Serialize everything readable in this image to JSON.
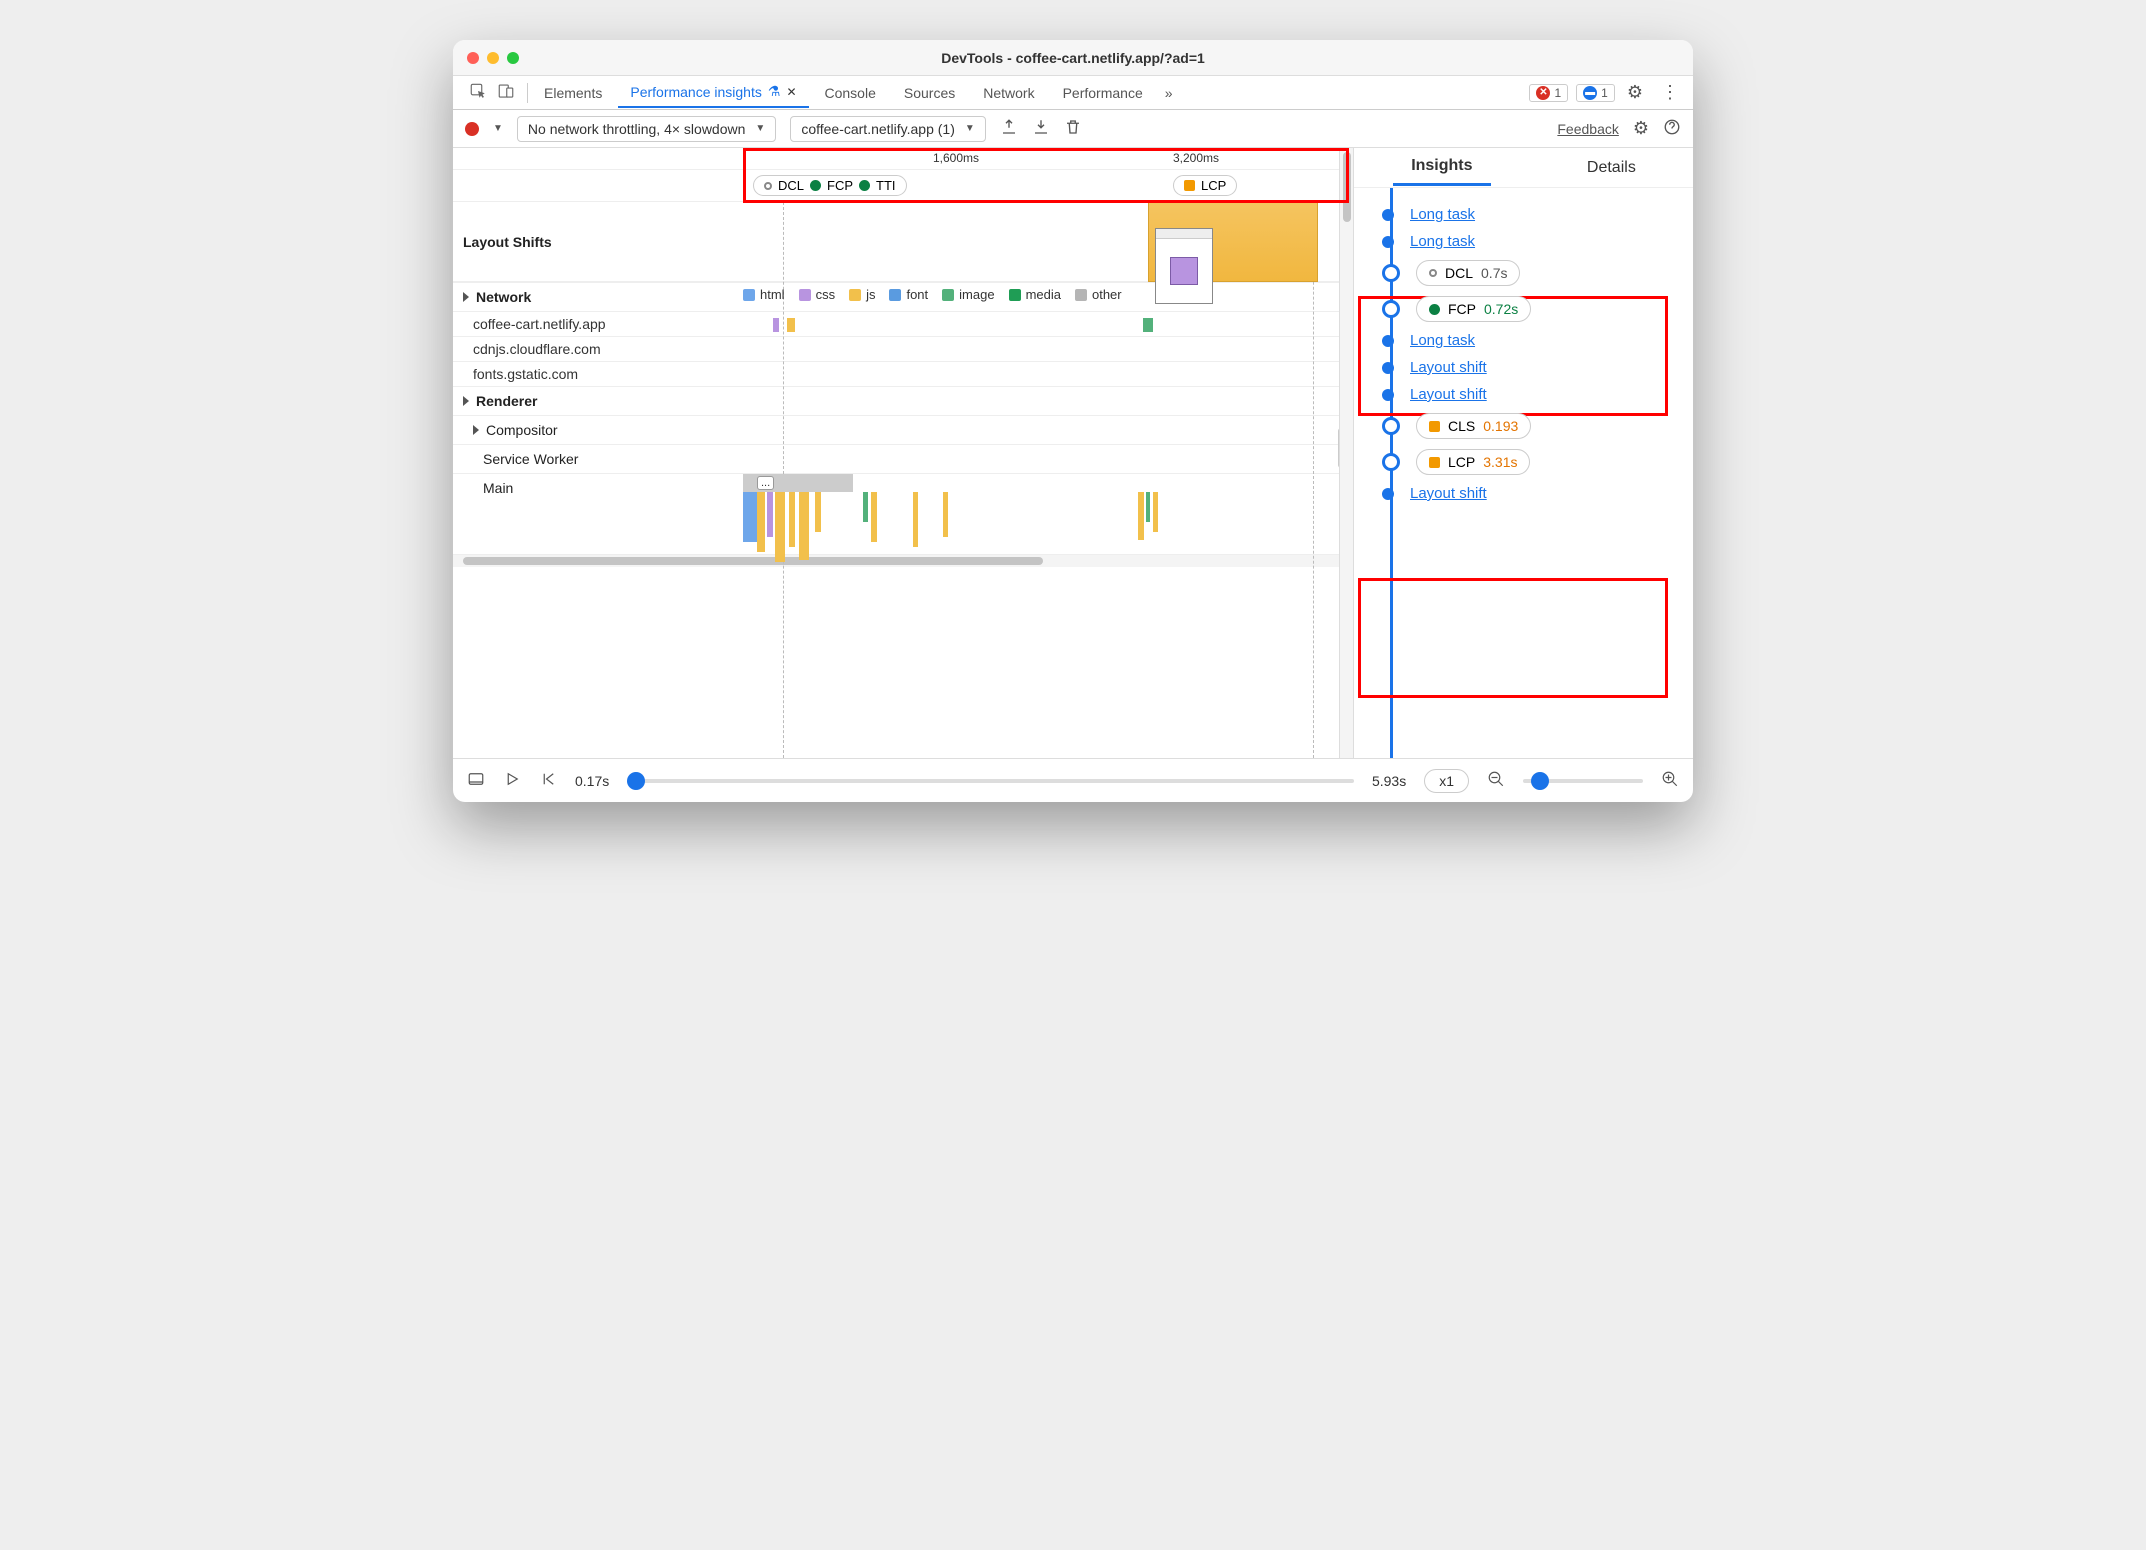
{
  "window": {
    "title": "DevTools - coffee-cart.netlify.app/?ad=1"
  },
  "tabs": {
    "items": [
      "Elements",
      "Performance insights",
      "Console",
      "Sources",
      "Network",
      "Performance"
    ],
    "active": "Performance insights",
    "overflow_chevron": "»",
    "errors_count": "1",
    "messages_count": "1"
  },
  "toolbar": {
    "throttling": "No network throttling, 4× slowdown",
    "page_select": "coffee-cart.netlify.app (1)",
    "feedback": "Feedback"
  },
  "ruler": {
    "t1": "1,600ms",
    "t2": "3,200ms"
  },
  "markers": {
    "group1": [
      "DCL",
      "FCP",
      "TTI"
    ],
    "group2": [
      "LCP"
    ]
  },
  "tracks": {
    "layout_shifts": "Layout Shifts",
    "network": "Network",
    "renderer": "Renderer",
    "compositor": "Compositor",
    "service_worker": "Service Worker",
    "main": "Main"
  },
  "legend": {
    "html": "html",
    "css": "css",
    "js": "js",
    "font": "font",
    "image": "image",
    "media": "media",
    "other": "other"
  },
  "network_rows": [
    "coffee-cart.netlify.app",
    "cdnjs.cloudflare.com",
    "fonts.gstatic.com"
  ],
  "insights_panel": {
    "tabs": [
      "Insights",
      "Details"
    ],
    "items": [
      {
        "kind": "link",
        "label": "Long task"
      },
      {
        "kind": "link",
        "label": "Long task"
      },
      {
        "kind": "metric",
        "icon": "hollow",
        "name": "DCL",
        "value": "0.7s",
        "cls": "grey"
      },
      {
        "kind": "metric",
        "icon": "green",
        "name": "FCP",
        "value": "0.72s",
        "cls": "green"
      },
      {
        "kind": "link",
        "label": "Long task"
      },
      {
        "kind": "link",
        "label": "Layout shift"
      },
      {
        "kind": "link",
        "label": "Layout shift"
      },
      {
        "kind": "metric",
        "icon": "orange-sq",
        "name": "CLS",
        "value": "0.193",
        "cls": "orange"
      },
      {
        "kind": "metric",
        "icon": "orange-sq",
        "name": "LCP",
        "value": "3.31s",
        "cls": "orange"
      },
      {
        "kind": "link",
        "label": "Layout shift"
      }
    ]
  },
  "footer": {
    "start": "0.17s",
    "end": "5.93s",
    "speed": "x1"
  },
  "main_ellipsis": "..."
}
